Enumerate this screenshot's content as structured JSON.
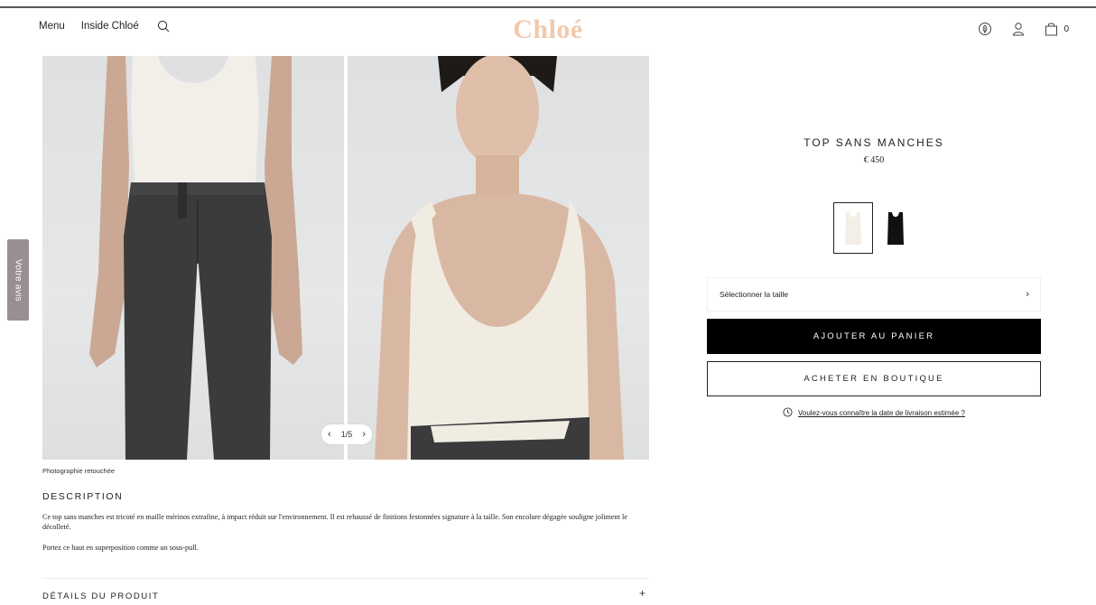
{
  "header": {
    "nav_left": [
      "Menu",
      "Inside Chloé"
    ],
    "logo": "Chloé",
    "cart_count": "0"
  },
  "gallery": {
    "pager": "1/5",
    "retouch_note": "Photographie retouchée"
  },
  "feedback_tab": "Votre avis",
  "description": {
    "title": "DESCRIPTION",
    "body": "Ce top sans manches est tricoté en maille mérinos extrafine, à impact réduit sur l'environnement. Il est rehaussé de finitions festonnées signature à la taille. Son encolure dégagée souligne joliment le décolleté.",
    "body2": "Portez ce haut en superposition comme un sous-pull."
  },
  "details": {
    "title": "DÉTAILS DU PRODUIT",
    "toggle": "+"
  },
  "product": {
    "title": "TOP SANS MANCHES",
    "price": "€ 450",
    "size_placeholder": "Sélectionner la taille",
    "add_to_cart": "AJOUTER AU PANIER",
    "buy_in_store": "ACHETER EN BOUTIQUE",
    "delivery_link": "Voulez-vous connaître la date de livraison estimée ?"
  },
  "colors": {
    "logo": "#f2c9ad",
    "feedback_tab": "#9a8f90",
    "primary_button": "#000000",
    "swatch_white": "#f3efe6",
    "swatch_black": "#111111"
  },
  "icons": [
    "search-icon",
    "leaf-icon",
    "user-icon",
    "bag-icon",
    "chevron-left-icon",
    "chevron-right-icon",
    "clock-icon"
  ]
}
